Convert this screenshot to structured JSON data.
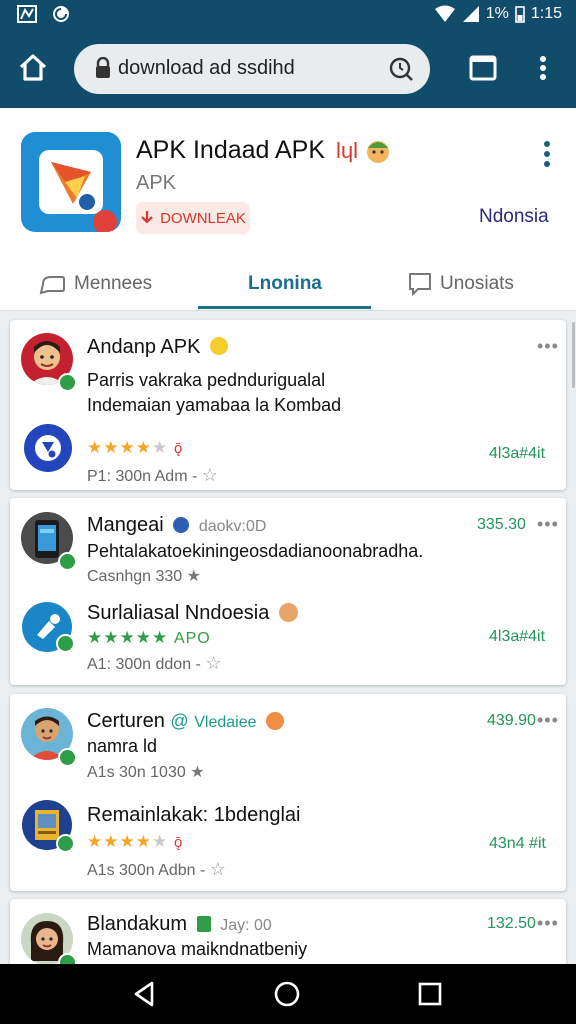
{
  "status_bar": {
    "battery": "1%",
    "time": "1:15"
  },
  "browser": {
    "url": "download ad ssdihd"
  },
  "app": {
    "title": "APK Indaad APK",
    "title_badge": "lɥl",
    "subtitle": "APK",
    "download_label": "DOWNLEAK",
    "region": "Ndonsia"
  },
  "tabs": [
    {
      "label": "Mennees",
      "icon": "speech-bubble-icon"
    },
    {
      "label": "Lnonina",
      "active": true
    },
    {
      "label": "Unosiats",
      "icon": "chat-square-icon"
    }
  ],
  "cards": [
    {
      "avatar_name": "man-avatar",
      "name": "Andanp APK",
      "lines": [
        "Parris vakraka pedndurigualal",
        "Indemaian yamabaa la Kombad"
      ],
      "sub_name": "",
      "rating": 4,
      "rating_suffix": "ǭ",
      "meta": "P1: 300n Adm -",
      "price": "4l3a#4it"
    },
    {
      "avatar_name": "phone-avatar",
      "name": "Mangeai",
      "name_extra": "daokv:0D",
      "price_top": "335.30",
      "lines": [
        "Pehtalakatoekiningeosdadianoonabradha."
      ],
      "meta_top": "Casnhgn 330",
      "sub_name": "Surlaliasal Nndoesia",
      "rating": 5,
      "rating_suffix": "APO",
      "meta": "A1: 300n ddon -",
      "price": "4l3a#4it"
    },
    {
      "avatar_name": "boy-avatar",
      "name": "Certuren",
      "name_extra": "Vledaiee",
      "price_top": "439.90",
      "lines": [
        "namra ld"
      ],
      "meta_top": "A1s 30n 1030",
      "sub_name": "Remainlakak: 1bdenglai",
      "rating": 4,
      "rating_suffix": "ǭ",
      "meta": "A1s 300n Adbn -",
      "price": "43n4 #it"
    },
    {
      "avatar_name": "woman-avatar",
      "name": "Blandakum",
      "name_extra": "Jay: 00",
      "price_top": "132.50",
      "lines": [
        "Mamanova maikndnatbeniy"
      ]
    }
  ],
  "colors": {
    "appbar": "#114d6b",
    "accent": "#1c6e8c",
    "price": "#23955a",
    "star": "#f5a623"
  }
}
